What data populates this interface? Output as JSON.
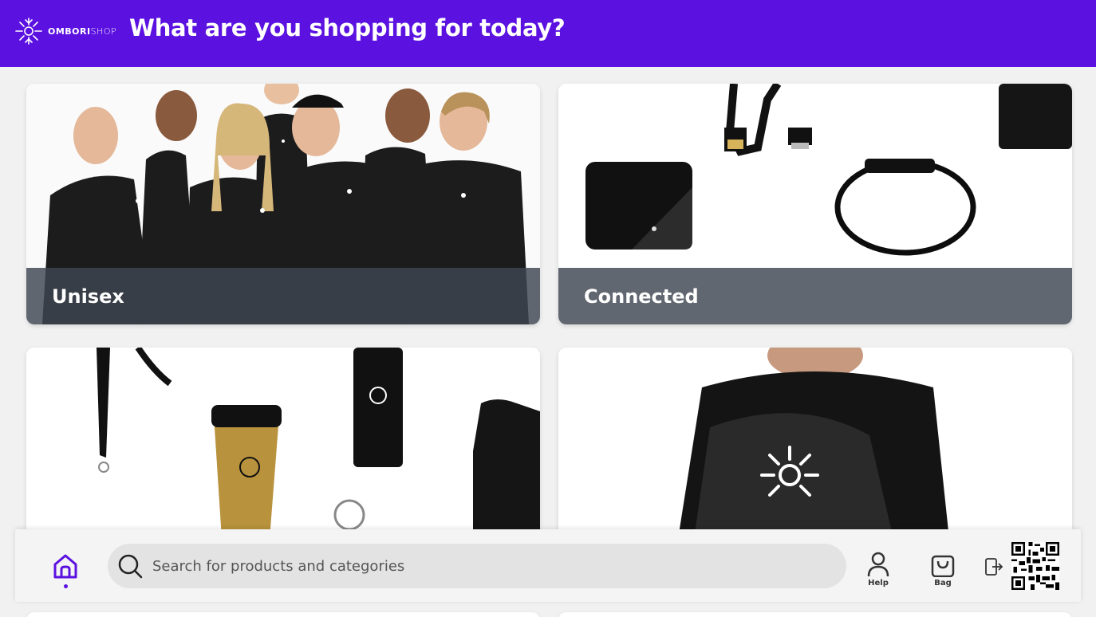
{
  "header": {
    "brand_bold": "OMBORI",
    "brand_light": "SHOP",
    "title": "What are you shopping for today?",
    "background": "#5b11e0"
  },
  "categories": [
    {
      "label": "Unisex"
    },
    {
      "label": "Connected"
    },
    {
      "label": ""
    },
    {
      "label": ""
    }
  ],
  "bottom_bar": {
    "home_icon": "home-icon",
    "search_placeholder": "Search for products and categories",
    "help_label": "Help",
    "bag_label": "Bag",
    "exit_icon": "exit-icon",
    "qr_icon": "qr-code"
  },
  "colors": {
    "accent": "#5b11e0",
    "label_overlay": "#3e4650"
  }
}
